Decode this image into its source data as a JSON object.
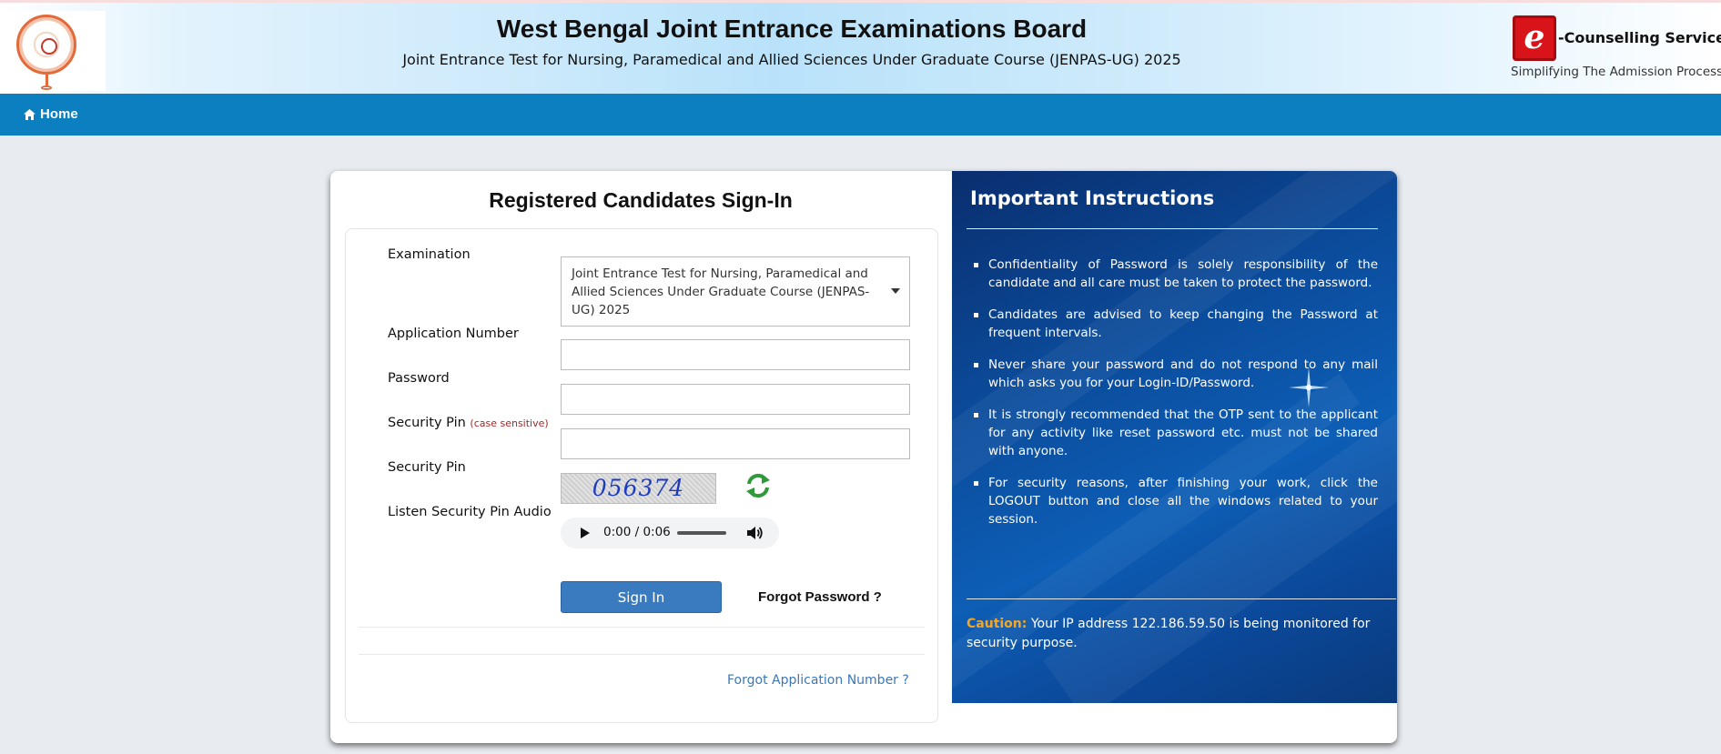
{
  "header": {
    "title": "West Bengal Joint Entrance Examinations Board",
    "subtitle": "Joint Entrance Test for Nursing, Paramedical and Allied Sciences Under Graduate Course (JENPAS-UG) 2025",
    "brand": "-Counselling Services",
    "brand_badge": "e",
    "tagline": "Simplifying The Admission Process"
  },
  "nav": {
    "home_label": "Home"
  },
  "signin": {
    "title": "Registered Candidates Sign-In",
    "examination_label": "Examination",
    "examination_value": "Joint Entrance Test for Nursing, Paramedical and Allied Sciences Under Graduate Course (JENPAS-UG) 2025",
    "application_label": "Application Number",
    "password_label": "Password",
    "security_pin_label": "Security Pin",
    "case_sensitive": "(case sensitive)",
    "security_pin_image_label": "Security Pin",
    "captcha_text": "056374",
    "audio_label": "Listen Security Pin Audio",
    "audio_time": "0:00 / 0:06",
    "signin_button": "Sign In",
    "forgot_password": "Forgot Password ?",
    "forgot_application": "Forgot Application Number ?"
  },
  "instructions": {
    "title": "Important Instructions",
    "items": [
      "Confidentiality of Password is solely responsibility of the candidate and all care must be taken to protect the password.",
      "Candidates are advised to keep changing the Password at frequent intervals.",
      "Never share your password and do not respond to any mail which asks you for your Login-ID/Password.",
      "It is strongly recommended that the OTP sent to the applicant for any activity like reset password etc. must not be shared with anyone.",
      "For security reasons, after finishing your work, click the LOGOUT button and close all the windows related to your session."
    ],
    "caution_label": "Caution:",
    "caution_text": " Your IP address 122.186.59.50 is being monitored for security purpose."
  },
  "colors": {
    "nav": "#0b7fbf",
    "button": "#3a7bc0",
    "panel": "#0b4c9c",
    "caution": "#f5a623",
    "badge": "#d9131a"
  }
}
